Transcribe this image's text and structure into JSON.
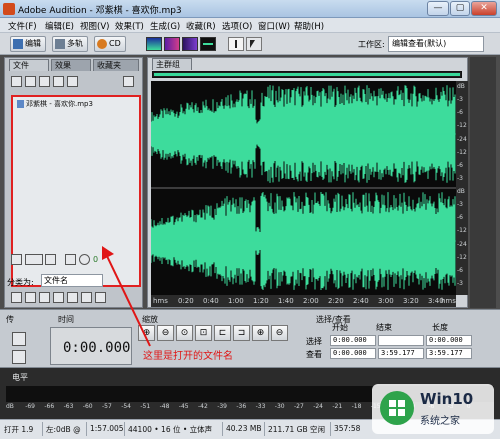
{
  "window": {
    "title": "Adobe Audition - 邓紫棋 - 喜欢你.mp3",
    "min_label": "—",
    "max_label": "▢",
    "close_label": "✕"
  },
  "menu": [
    "文件(F)",
    "编辑(E)",
    "视图(V)",
    "效果(T)",
    "生成(G)",
    "收藏(R)",
    "选项(O)",
    "窗口(W)",
    "帮助(H)"
  ],
  "toolbar": {
    "edit_label": "编辑",
    "multitrack_label": "多轨",
    "cd_label": "CD",
    "workspace_label": "工作区:",
    "workspace_value": "编辑查看(默认)"
  },
  "left_panel": {
    "tabs": [
      "文件",
      "效果",
      "收藏夹"
    ],
    "file_name": "邓紫棋 - 喜欢你.mp3",
    "level_value": "0",
    "sort_label": "分类为:",
    "sort_value": "文件名"
  },
  "main_panel": {
    "tab": "主群组",
    "time_ticks": [
      "hms",
      "0:20",
      "0:40",
      "1:00",
      "1:20",
      "1:40",
      "2:00",
      "2:20",
      "2:40",
      "3:00",
      "3:20",
      "3:40",
      "hms"
    ],
    "db_ticks": [
      "dB",
      "-3",
      "-6",
      "-12",
      "-24",
      "-12",
      "-6",
      "-3",
      "dB",
      "-3",
      "-6",
      "-12",
      "-24",
      "-12",
      "-6",
      "-3"
    ]
  },
  "lower": {
    "transport_tab": "传",
    "time_tab": "时间",
    "time_value": "0:00.000",
    "zoom_tab": "缩放",
    "annotation": "这里是打开的文件名",
    "selview_tab": "选择/查看",
    "col_start": "开始",
    "col_end": "结束",
    "col_length": "长度",
    "row_select": "选择",
    "row_view": "查看",
    "sel_start": "0:00.000",
    "sel_end": "",
    "sel_length": "0:00.000",
    "view_start": "0:00.000",
    "view_end": "3:59.177",
    "view_length": "3:59.177"
  },
  "levels": {
    "tab": "电平",
    "scale": [
      "dB",
      "-69",
      "-66",
      "-63",
      "-60",
      "-57",
      "-54",
      "-51",
      "-48",
      "-45",
      "-42",
      "-39",
      "-36",
      "-33",
      "-30",
      "-27",
      "-24",
      "-21",
      "-18",
      "-15",
      "-12",
      "-9",
      "-6",
      "-3",
      "0"
    ]
  },
  "status": {
    "open_time": "打开 1.9",
    "position": "左:0dB @",
    "time": "1:57.005",
    "format": "44100 • 16 位 • 立体声",
    "size": "40.23 MB",
    "free": "211.71 GB 空闲",
    "free2": "357:58"
  },
  "watermark": {
    "title": "Win10",
    "subtitle": "系统之家"
  },
  "colors": {
    "waveform": "#3ddc9c",
    "annotation": "#e01616"
  }
}
